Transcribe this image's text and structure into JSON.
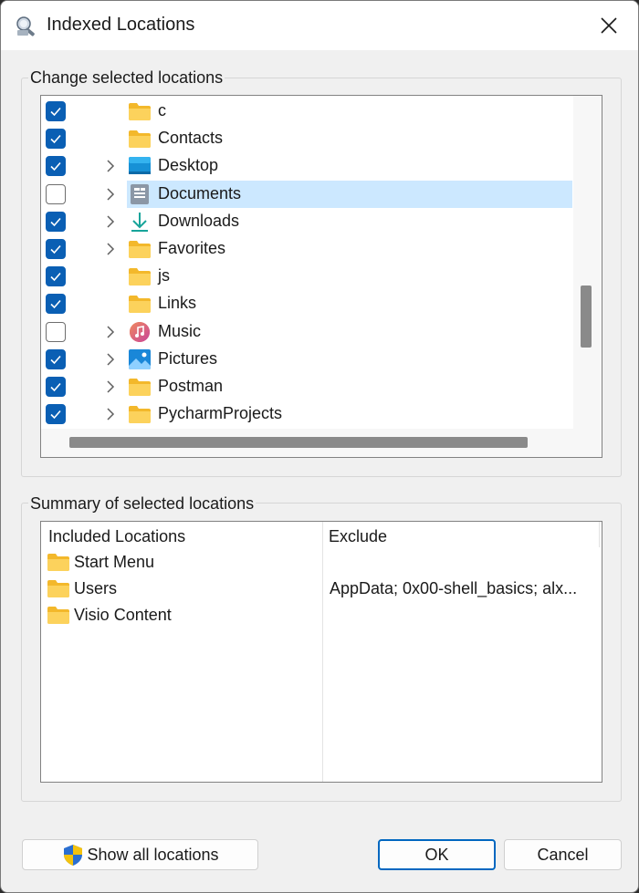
{
  "window": {
    "title": "Indexed Locations"
  },
  "change_group": {
    "label": "Change selected locations",
    "items": [
      {
        "label": "c",
        "checked": true,
        "expandable": false,
        "icon": "folder-icon"
      },
      {
        "label": "Contacts",
        "checked": true,
        "expandable": false,
        "icon": "folder-icon"
      },
      {
        "label": "Desktop",
        "checked": true,
        "expandable": true,
        "icon": "desktop-icon"
      },
      {
        "label": "Documents",
        "checked": false,
        "expandable": true,
        "icon": "documents-icon",
        "selected": true
      },
      {
        "label": "Downloads",
        "checked": true,
        "expandable": true,
        "icon": "downloads-icon"
      },
      {
        "label": "Favorites",
        "checked": true,
        "expandable": true,
        "icon": "folder-icon"
      },
      {
        "label": "js",
        "checked": true,
        "expandable": false,
        "icon": "folder-icon"
      },
      {
        "label": "Links",
        "checked": true,
        "expandable": false,
        "icon": "folder-icon"
      },
      {
        "label": "Music",
        "checked": false,
        "expandable": true,
        "icon": "music-icon"
      },
      {
        "label": "Pictures",
        "checked": true,
        "expandable": true,
        "icon": "pictures-icon"
      },
      {
        "label": "Postman",
        "checked": true,
        "expandable": true,
        "icon": "folder-icon"
      },
      {
        "label": "PycharmProjects",
        "checked": true,
        "expandable": true,
        "icon": "folder-icon"
      }
    ]
  },
  "summary_group": {
    "label": "Summary of selected locations",
    "col_included": "Included Locations",
    "col_exclude": "Exclude",
    "included": [
      "Start Menu",
      "Users",
      "Visio Content"
    ],
    "exclude": [
      "",
      "AppData; 0x00-shell_basics; alx...",
      ""
    ]
  },
  "buttons": {
    "show_all": "Show all locations",
    "ok": "OK",
    "cancel": "Cancel"
  },
  "colors": {
    "accent": "#0a5fb4",
    "selection": "#cce8ff",
    "folder": "#f8c93a"
  }
}
